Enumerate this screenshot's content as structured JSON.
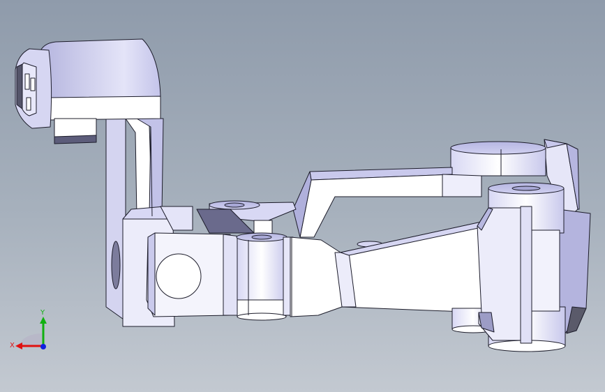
{
  "colors": {
    "bg_top": "#8f9bab",
    "bg_bottom": "#c3c9d1",
    "face_light": "#ffffff",
    "face_mid": "#dcdcf2",
    "face_shade": "#b8b8e0",
    "face_dark": "#8e8eb4",
    "edge": "#1c1c2a",
    "axis_x": "#e01010",
    "axis_y": "#10b010",
    "axis_z": "#1020e0"
  },
  "triad": {
    "x_label": "X",
    "y_label": "Y"
  }
}
